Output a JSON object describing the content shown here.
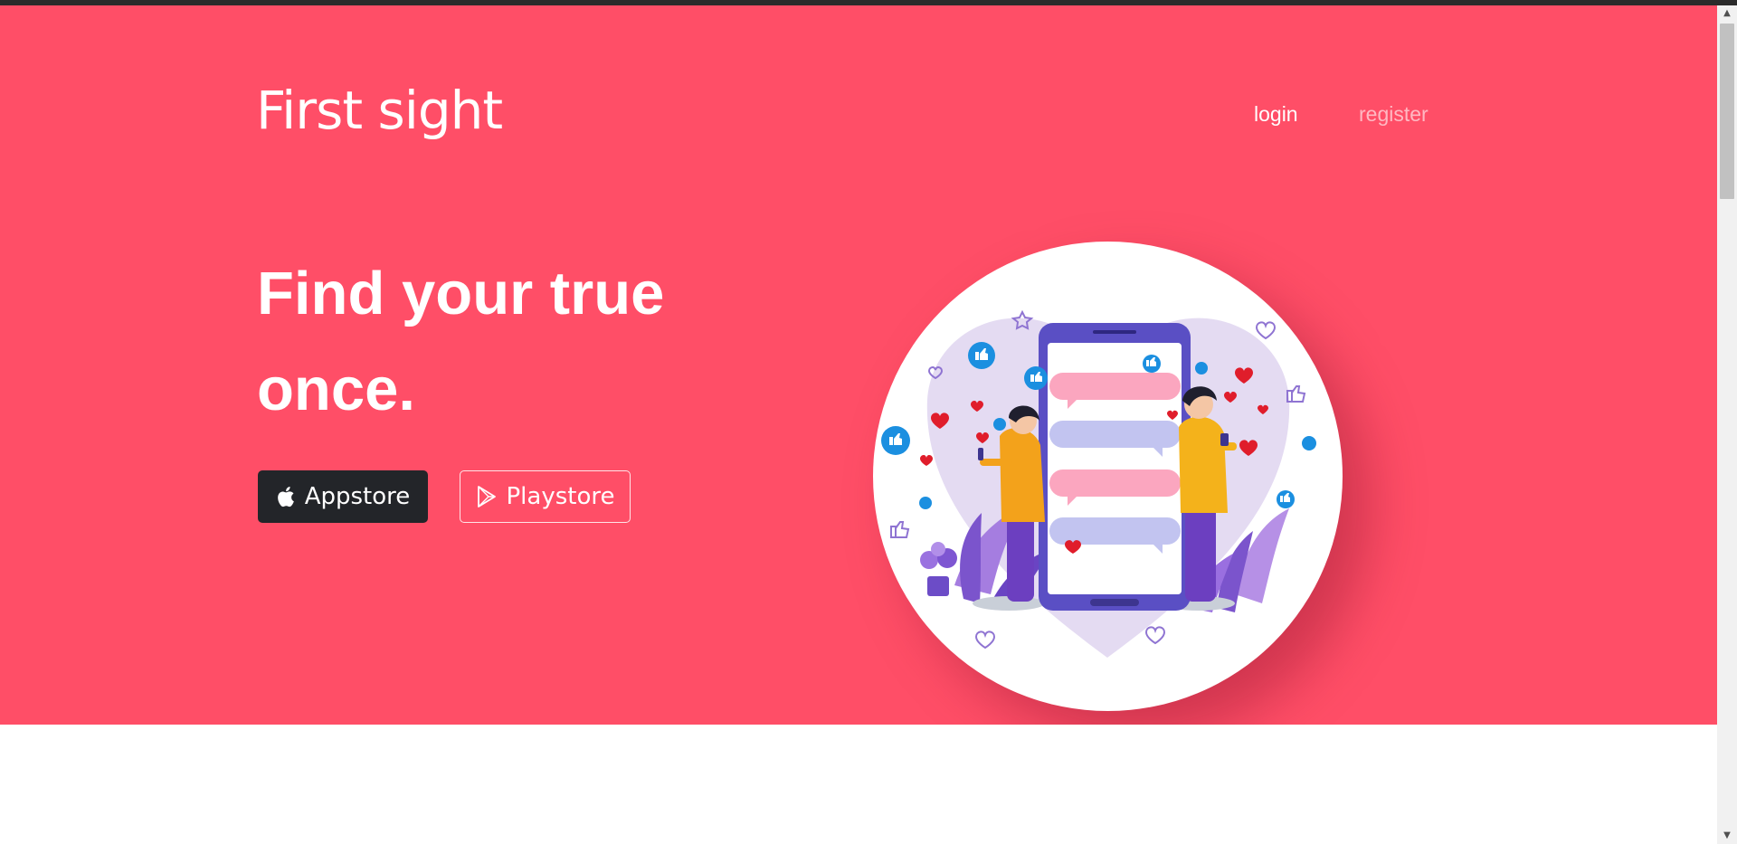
{
  "header": {
    "brand": "First sight",
    "nav": {
      "login": "login",
      "register": "register"
    }
  },
  "hero": {
    "headline": "Find your true once.",
    "buttons": {
      "appstore": "Appstore",
      "playstore": "Playstore"
    },
    "illustration_icons": [
      "heart-icon",
      "thumbs-up-icon",
      "star-icon",
      "smartphone-icon",
      "chat-bubble-icon"
    ]
  },
  "colors": {
    "hero_background": "#ff4e67",
    "appstore_button": "#232529",
    "phone_frame": "#5a4fc4",
    "bubble_pink": "#fba6bf",
    "bubble_lavender": "#c2c4f0"
  }
}
